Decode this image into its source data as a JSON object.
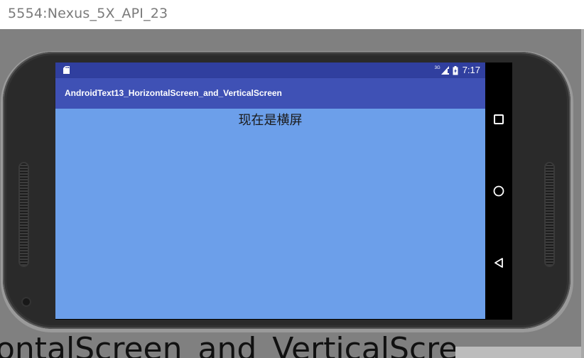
{
  "window": {
    "title": "5554:Nexus_5X_API_23"
  },
  "background": {
    "partial_text": "ontalScreen_and_VerticalScre"
  },
  "status_bar": {
    "network_type": "3G",
    "time": "7:17",
    "icons": [
      "sd-card-icon",
      "signal-icon",
      "battery-charging-icon"
    ]
  },
  "app_bar": {
    "title": "AndroidText13_HorizontalScreen_and_VerticalScreen"
  },
  "content": {
    "message": "现在是横屏",
    "background_color": "#6c9fea"
  },
  "nav_bar": {
    "buttons": [
      "recents-icon",
      "home-icon",
      "back-icon"
    ]
  },
  "colors": {
    "status_bar": "#303f9f",
    "app_bar": "#3f51b5",
    "emulator_backdrop": "#808080"
  }
}
